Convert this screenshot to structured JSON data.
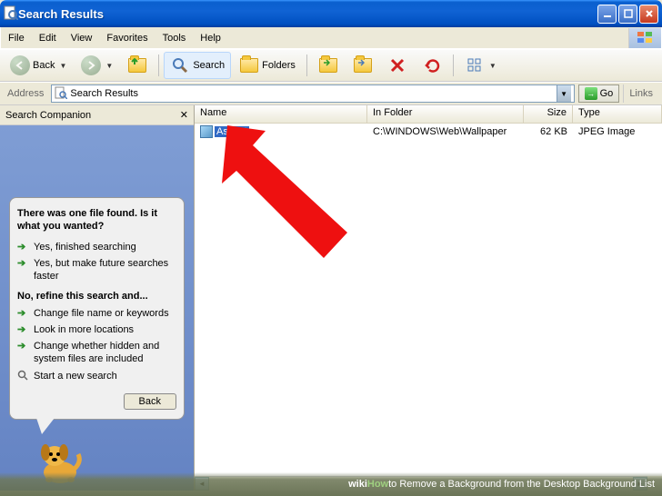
{
  "titlebar": {
    "title": "Search Results"
  },
  "menu": {
    "file": "File",
    "edit": "Edit",
    "view": "View",
    "favorites": "Favorites",
    "tools": "Tools",
    "help": "Help"
  },
  "toolbar": {
    "back": "Back",
    "search": "Search",
    "folders": "Folders"
  },
  "address": {
    "label": "Address",
    "value": "Search Results",
    "go": "Go",
    "links": "Links"
  },
  "sidebar": {
    "title": "Search Companion",
    "balloon": {
      "question": "There was one file found.  Is it what you wanted?",
      "opt_finished": "Yes, finished searching",
      "opt_faster": "Yes, but make future searches faster",
      "refine_label": "No, refine this search and...",
      "opt_name": "Change file name or keywords",
      "opt_locations": "Look in more locations",
      "opt_hidden": "Change whether hidden and system files are included",
      "opt_new": "Start a new search",
      "back": "Back"
    }
  },
  "columns": {
    "name": "Name",
    "folder": "In Folder",
    "size": "Size",
    "type": "Type"
  },
  "rows": [
    {
      "name": "Ascent",
      "folder": "C:\\WINDOWS\\Web\\Wallpaper",
      "size": "62 KB",
      "type": "JPEG Image"
    }
  ],
  "banner": {
    "wiki": "wiki",
    "how": "How",
    "text": " to Remove a Background from the Desktop Background List"
  }
}
